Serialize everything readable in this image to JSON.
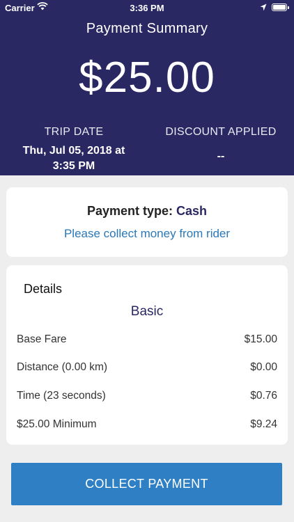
{
  "status_bar": {
    "carrier": "Carrier",
    "time": "3:36 PM"
  },
  "header": {
    "title": "Payment Summary",
    "amount": "$25.00",
    "trip_date_label": "TRIP DATE",
    "trip_date_line1": "Thu, Jul 05, 2018 at",
    "trip_date_line2": "3:35 PM",
    "discount_label": "DISCOUNT APPLIED",
    "discount_value": "--"
  },
  "payment": {
    "type_label": "Payment type:",
    "type_value": "Cash",
    "message": "Please collect money from rider"
  },
  "details": {
    "title": "Details",
    "plan": "Basic",
    "rows": [
      {
        "label": "Base Fare",
        "value": "$15.00"
      },
      {
        "label": "Distance (0.00 km)",
        "value": "$0.00"
      },
      {
        "label": "Time (23 seconds)",
        "value": "$0.76"
      },
      {
        "label": "$25.00 Minimum",
        "value": "$9.24"
      }
    ]
  },
  "action": {
    "collect_label": "COLLECT PAYMENT"
  },
  "colors": {
    "header_bg": "#2a2862",
    "accent_blue": "#2f7fc4",
    "link_blue": "#2a78b7"
  }
}
